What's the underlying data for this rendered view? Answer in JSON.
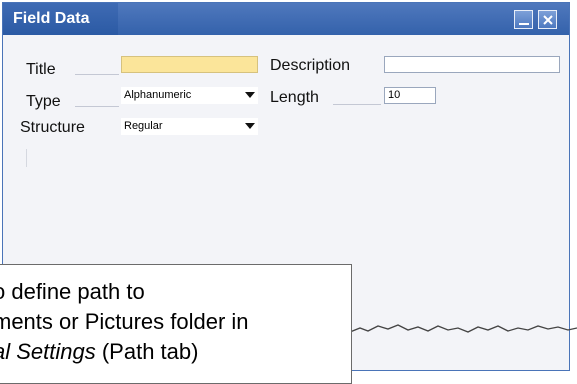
{
  "window": {
    "title": "Field Data"
  },
  "fields": {
    "title_label": "Title",
    "title_value": "",
    "description_label": "Description",
    "description_value": "",
    "type_label": "Type",
    "type_value": "Alphanumeric",
    "length_label": "Length",
    "length_value": "10",
    "structure_label": "Structure",
    "structure_value": "Regular"
  },
  "callout": {
    "line1": "o define path to",
    "line2": "ments or Pictures folder in",
    "line3_italic": "al Settings",
    "line3_rest": " (Path tab)"
  },
  "colors": {
    "titlebar": "#3462ab",
    "title_field": "#fbe59a"
  }
}
